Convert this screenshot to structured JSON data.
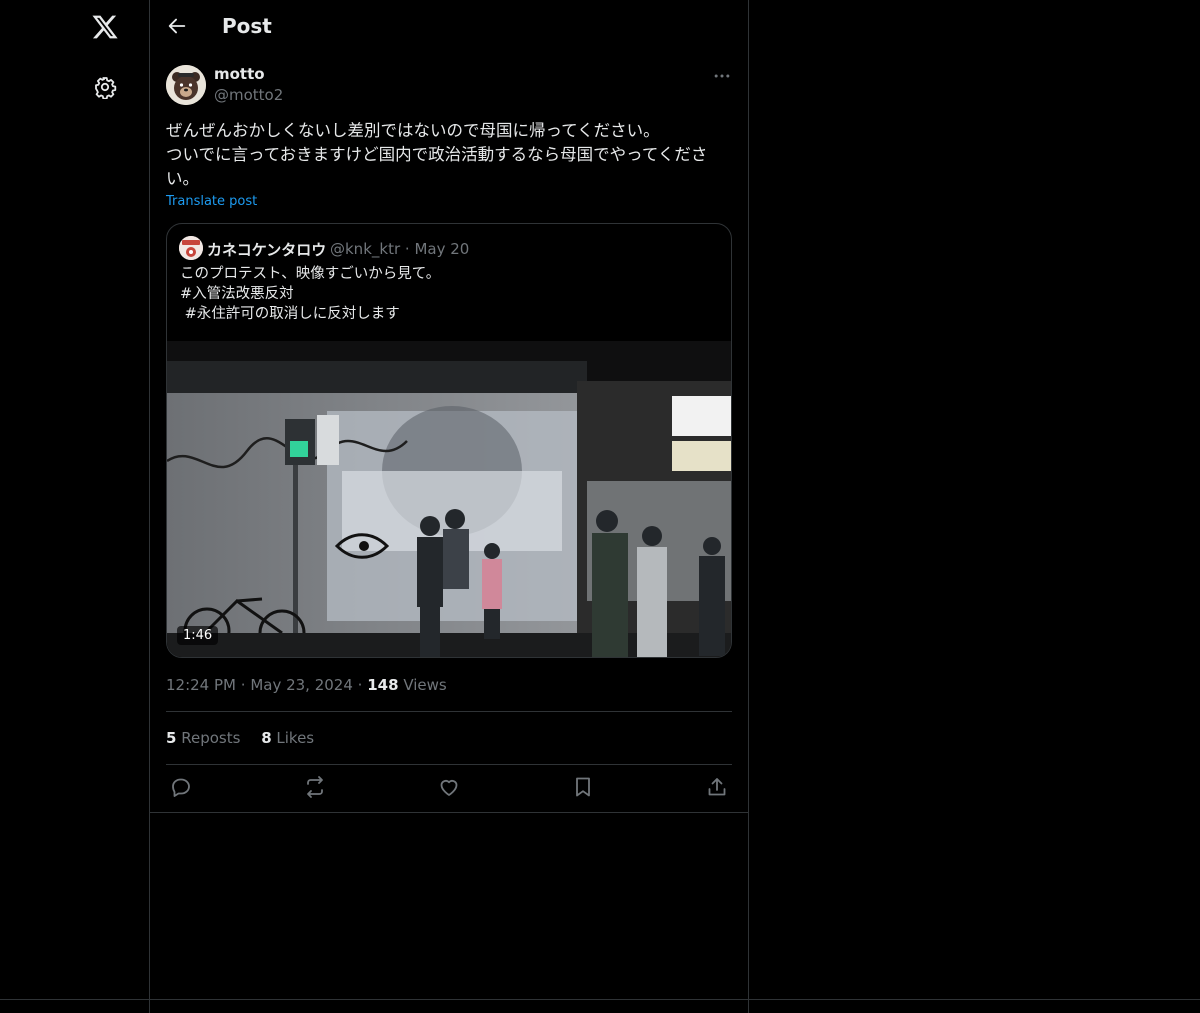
{
  "header": {
    "title": "Post"
  },
  "post": {
    "author_name": "motto",
    "author_handle": "@motto2",
    "text": "ぜんぜんおかしくないし差別ではないので母国に帰ってください。\nついでに言っておきますけど国内で政治活動するなら母国でやってください。",
    "translate_label": "Translate post",
    "time": "12:24 PM",
    "date": "May 23, 2024",
    "views_count": "148",
    "views_label": "Views",
    "reposts_count": "5",
    "reposts_label": "Reposts",
    "likes_count": "8",
    "likes_label": "Likes"
  },
  "quote": {
    "author_name": "カネコケンタロウ",
    "author_handle": "@knk_ktr",
    "date": "May 20",
    "text": "このプロテスト、映像すごいから見て。\n#入管法改悪反対\n #永住許可の取消しに反対します",
    "video_duration": "1:46"
  },
  "icons": {
    "logo": "x-logo-icon",
    "settings": "gear-icon",
    "back": "arrow-left-icon",
    "more": "more-horizontal-icon",
    "reply": "reply-icon",
    "repost": "repost-icon",
    "like": "heart-icon",
    "bookmark": "bookmark-icon",
    "share": "share-icon"
  },
  "colors": {
    "background": "#000000",
    "text_primary": "#e7e9ea",
    "text_secondary": "#71767b",
    "link": "#1d9bf0",
    "border": "#2f3336"
  }
}
